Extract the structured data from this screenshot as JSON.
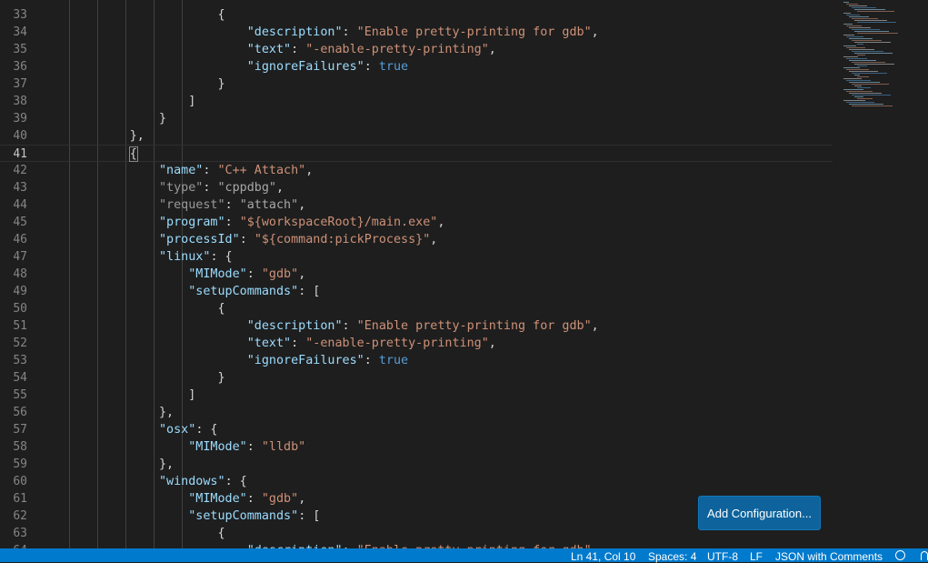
{
  "editor": {
    "current_line": "41",
    "lines": [
      {
        "n": "33",
        "tokens": [
          {
            "t": "                        "
          },
          {
            "t": "{",
            "c": "p"
          }
        ]
      },
      {
        "n": "34",
        "tokens": [
          {
            "t": "                            "
          },
          {
            "t": "\"description\"",
            "c": "k"
          },
          {
            "t": ": ",
            "c": "p"
          },
          {
            "t": "\"Enable pretty-printing for gdb\"",
            "c": "s"
          },
          {
            "t": ",",
            "c": "p"
          }
        ]
      },
      {
        "n": "35",
        "tokens": [
          {
            "t": "                            "
          },
          {
            "t": "\"text\"",
            "c": "k"
          },
          {
            "t": ": ",
            "c": "p"
          },
          {
            "t": "\"-enable-pretty-printing\"",
            "c": "s"
          },
          {
            "t": ",",
            "c": "p"
          }
        ]
      },
      {
        "n": "36",
        "tokens": [
          {
            "t": "                            "
          },
          {
            "t": "\"ignoreFailures\"",
            "c": "k"
          },
          {
            "t": ": ",
            "c": "p"
          },
          {
            "t": "true",
            "c": "b"
          }
        ]
      },
      {
        "n": "37",
        "tokens": [
          {
            "t": "                        "
          },
          {
            "t": "}",
            "c": "p"
          }
        ]
      },
      {
        "n": "38",
        "tokens": [
          {
            "t": "                    "
          },
          {
            "t": "]",
            "c": "p"
          }
        ]
      },
      {
        "n": "39",
        "tokens": [
          {
            "t": "                "
          },
          {
            "t": "}",
            "c": "p"
          }
        ]
      },
      {
        "n": "40",
        "tokens": [
          {
            "t": "            "
          },
          {
            "t": "},",
            "c": "p"
          }
        ]
      },
      {
        "n": "41",
        "tokens": [
          {
            "t": "            "
          },
          {
            "t": "{",
            "c": "br"
          }
        ]
      },
      {
        "n": "42",
        "tokens": [
          {
            "t": "                "
          },
          {
            "t": "\"name\"",
            "c": "k"
          },
          {
            "t": ": ",
            "c": "p"
          },
          {
            "t": "\"C++ Attach\"",
            "c": "s"
          },
          {
            "t": ",",
            "c": "p"
          }
        ]
      },
      {
        "n": "43",
        "tokens": [
          {
            "t": "                "
          },
          {
            "t": "\"type\"",
            "c": "dk"
          },
          {
            "t": ": ",
            "c": "p"
          },
          {
            "t": "\"cppdbg\"",
            "c": "ds"
          },
          {
            "t": ",",
            "c": "p"
          }
        ]
      },
      {
        "n": "44",
        "tokens": [
          {
            "t": "                "
          },
          {
            "t": "\"request\"",
            "c": "dk"
          },
          {
            "t": ": ",
            "c": "p"
          },
          {
            "t": "\"attach\"",
            "c": "ds"
          },
          {
            "t": ",",
            "c": "p"
          }
        ]
      },
      {
        "n": "45",
        "tokens": [
          {
            "t": "                "
          },
          {
            "t": "\"program\"",
            "c": "k"
          },
          {
            "t": ": ",
            "c": "p"
          },
          {
            "t": "\"${workspaceRoot}/main.exe\"",
            "c": "s"
          },
          {
            "t": ",",
            "c": "p"
          }
        ]
      },
      {
        "n": "46",
        "tokens": [
          {
            "t": "                "
          },
          {
            "t": "\"processId\"",
            "c": "k"
          },
          {
            "t": ": ",
            "c": "p"
          },
          {
            "t": "\"${command:pickProcess}\"",
            "c": "s"
          },
          {
            "t": ",",
            "c": "p"
          }
        ]
      },
      {
        "n": "47",
        "tokens": [
          {
            "t": "                "
          },
          {
            "t": "\"linux\"",
            "c": "k"
          },
          {
            "t": ": {",
            "c": "p"
          }
        ]
      },
      {
        "n": "48",
        "tokens": [
          {
            "t": "                    "
          },
          {
            "t": "\"MIMode\"",
            "c": "k"
          },
          {
            "t": ": ",
            "c": "p"
          },
          {
            "t": "\"gdb\"",
            "c": "s"
          },
          {
            "t": ",",
            "c": "p"
          }
        ]
      },
      {
        "n": "49",
        "tokens": [
          {
            "t": "                    "
          },
          {
            "t": "\"setupCommands\"",
            "c": "k"
          },
          {
            "t": ": [",
            "c": "p"
          }
        ]
      },
      {
        "n": "50",
        "tokens": [
          {
            "t": "                        "
          },
          {
            "t": "{",
            "c": "p"
          }
        ]
      },
      {
        "n": "51",
        "tokens": [
          {
            "t": "                            "
          },
          {
            "t": "\"description\"",
            "c": "k"
          },
          {
            "t": ": ",
            "c": "p"
          },
          {
            "t": "\"Enable pretty-printing for gdb\"",
            "c": "s"
          },
          {
            "t": ",",
            "c": "p"
          }
        ]
      },
      {
        "n": "52",
        "tokens": [
          {
            "t": "                            "
          },
          {
            "t": "\"text\"",
            "c": "k"
          },
          {
            "t": ": ",
            "c": "p"
          },
          {
            "t": "\"-enable-pretty-printing\"",
            "c": "s"
          },
          {
            "t": ",",
            "c": "p"
          }
        ]
      },
      {
        "n": "53",
        "tokens": [
          {
            "t": "                            "
          },
          {
            "t": "\"ignoreFailures\"",
            "c": "k"
          },
          {
            "t": ": ",
            "c": "p"
          },
          {
            "t": "true",
            "c": "b"
          }
        ]
      },
      {
        "n": "54",
        "tokens": [
          {
            "t": "                        "
          },
          {
            "t": "}",
            "c": "p"
          }
        ]
      },
      {
        "n": "55",
        "tokens": [
          {
            "t": "                    "
          },
          {
            "t": "]",
            "c": "p"
          }
        ]
      },
      {
        "n": "56",
        "tokens": [
          {
            "t": "                "
          },
          {
            "t": "},",
            "c": "p"
          }
        ]
      },
      {
        "n": "57",
        "tokens": [
          {
            "t": "                "
          },
          {
            "t": "\"osx\"",
            "c": "k"
          },
          {
            "t": ": {",
            "c": "p"
          }
        ]
      },
      {
        "n": "58",
        "tokens": [
          {
            "t": "                    "
          },
          {
            "t": "\"MIMode\"",
            "c": "k"
          },
          {
            "t": ": ",
            "c": "p"
          },
          {
            "t": "\"lldb\"",
            "c": "s"
          }
        ]
      },
      {
        "n": "59",
        "tokens": [
          {
            "t": "                "
          },
          {
            "t": "},",
            "c": "p"
          }
        ]
      },
      {
        "n": "60",
        "tokens": [
          {
            "t": "                "
          },
          {
            "t": "\"windows\"",
            "c": "k"
          },
          {
            "t": ": {",
            "c": "p"
          }
        ]
      },
      {
        "n": "61",
        "tokens": [
          {
            "t": "                    "
          },
          {
            "t": "\"MIMode\"",
            "c": "k"
          },
          {
            "t": ": ",
            "c": "p"
          },
          {
            "t": "\"gdb\"",
            "c": "s"
          },
          {
            "t": ",",
            "c": "p"
          }
        ]
      },
      {
        "n": "62",
        "tokens": [
          {
            "t": "                    "
          },
          {
            "t": "\"setupCommands\"",
            "c": "k"
          },
          {
            "t": ": [",
            "c": "p"
          }
        ]
      },
      {
        "n": "63",
        "tokens": [
          {
            "t": "                        "
          },
          {
            "t": "{",
            "c": "p"
          }
        ]
      },
      {
        "n": "64",
        "tokens": [
          {
            "t": "                            "
          },
          {
            "t": "\"description\"",
            "c": "k"
          },
          {
            "t": ": ",
            "c": "p"
          },
          {
            "t": "\"Enable pretty-printing for gdb\"",
            "c": "s"
          },
          {
            "t": ",",
            "c": "p"
          }
        ]
      }
    ]
  },
  "add_configuration_button": {
    "label": "Add Configuration..."
  },
  "statusbar": {
    "cursor_position": "Ln 41, Col 10",
    "indentation": "Spaces: 4",
    "encoding": "UTF-8",
    "line_ending": "LF",
    "language": "JSON with Comments",
    "feedback_icon": "smiley-icon",
    "notifications_icon": "bell-icon"
  },
  "colors": {
    "background": "#1e1e1e",
    "property_key": "#9cdcfe",
    "string_value": "#ce9178",
    "boolean_value": "#569cd6",
    "statusbar": "#007acc",
    "button": "#0e639c"
  }
}
